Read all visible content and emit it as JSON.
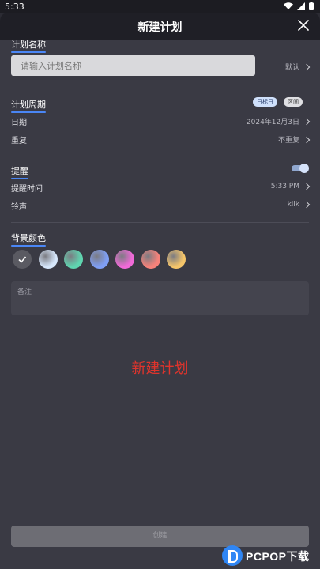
{
  "status": {
    "time": "5:33"
  },
  "header": {
    "title": "新建计划"
  },
  "name_section": {
    "title": "计划名称",
    "placeholder": "请输入计划名称",
    "default_label": "默认"
  },
  "period_section": {
    "title": "计划周期",
    "tags": [
      "日标日",
      "区间"
    ],
    "date_label": "日期",
    "date_value": "2024年12月3日",
    "repeat_label": "重复",
    "repeat_value": "不重复"
  },
  "reminder_section": {
    "title": "提醒",
    "enabled": true,
    "time_label": "提醒时间",
    "time_value": "5:33 PM",
    "ringtone_label": "铃声",
    "ringtone_value": "klik"
  },
  "color_section": {
    "title": "背景颜色",
    "colors": [
      "#5a5a62",
      "#d6e6fb",
      "#5fd5b0",
      "#7f9ff5",
      "#f06ad8",
      "#f6827a",
      "#f5c56a"
    ],
    "selected_index": 0
  },
  "notes": {
    "placeholder": "备注"
  },
  "overlay": {
    "caption": "新建计划"
  },
  "create_button": {
    "label": "创建"
  },
  "logo": {
    "text": "PCPOP下载"
  }
}
